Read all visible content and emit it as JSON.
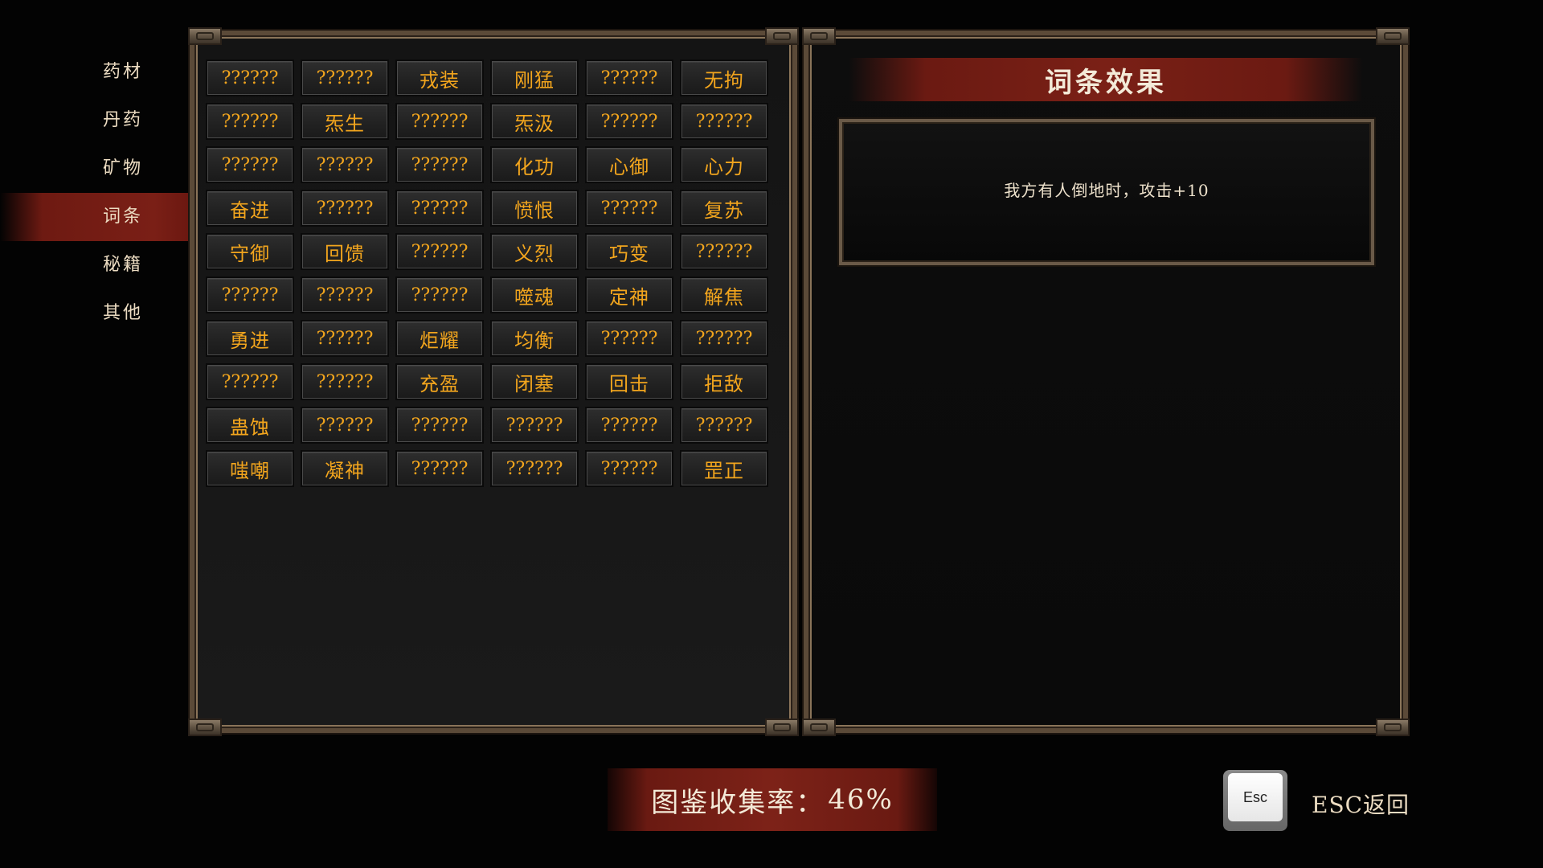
{
  "sidebar": {
    "items": [
      {
        "label": "药材"
      },
      {
        "label": "丹药"
      },
      {
        "label": "矿物"
      },
      {
        "label": "词条"
      },
      {
        "label": "秘籍"
      },
      {
        "label": "其他"
      }
    ],
    "active_index": 3
  },
  "grid": {
    "cells": [
      "??????",
      "??????",
      "戎装",
      "刚猛",
      "??????",
      "无拘",
      "??????",
      "炁生",
      "??????",
      "炁汲",
      "??????",
      "??????",
      "??????",
      "??????",
      "??????",
      "化功",
      "心御",
      "心力",
      "奋进",
      "??????",
      "??????",
      "愤恨",
      "??????",
      "复苏",
      "守御",
      "回馈",
      "??????",
      "义烈",
      "巧变",
      "??????",
      "??????",
      "??????",
      "??????",
      "噬魂",
      "定神",
      "解焦",
      "勇进",
      "??????",
      "炬耀",
      "均衡",
      "??????",
      "??????",
      "??????",
      "??????",
      "充盈",
      "闭塞",
      "回击",
      "拒敌",
      "蛊蚀",
      "??????",
      "??????",
      "??????",
      "??????",
      "??????",
      "嗤嘲",
      "凝神",
      "??????",
      "??????",
      "??????",
      "罡正"
    ]
  },
  "detail": {
    "title": "词条效果",
    "description": "我方有人倒地时，攻击+10"
  },
  "footer": {
    "collection_label": "图鉴收集率：",
    "collection_value": "46%",
    "esc_key": "Esc",
    "esc_label": "ESC返回"
  },
  "colors": {
    "accent_red": "#7a2016",
    "known_text": "#f2a51d",
    "frame_bronze": "#5b4a38"
  }
}
